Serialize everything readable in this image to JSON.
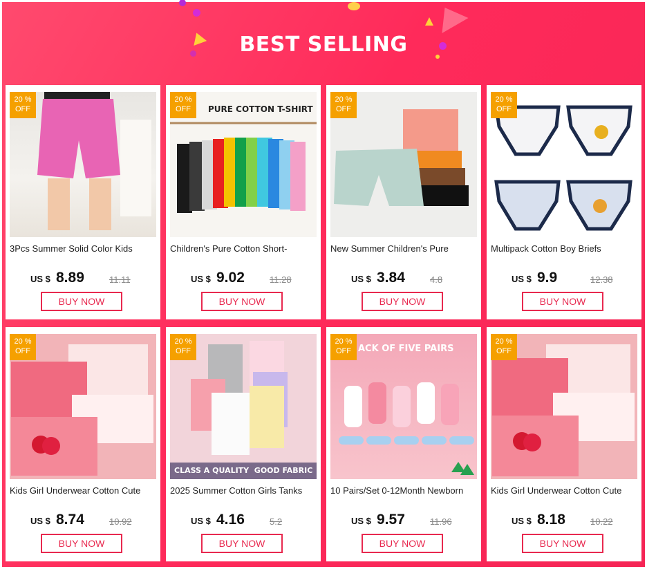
{
  "banner": {
    "title": "BEST SELLING"
  },
  "products": [
    {
      "badge_top": "20 %",
      "badge_bottom": "OFF",
      "title": "3Pcs Summer Solid Color Kids",
      "currency": "US $",
      "price": "8.89",
      "old_price": "11.11",
      "button": "BUY NOW"
    },
    {
      "badge_top": "20 %",
      "badge_bottom": "OFF",
      "title": "Children's Pure Cotton Short-",
      "currency": "US $",
      "price": "9.02",
      "old_price": "11.28",
      "button": "BUY NOW",
      "image_text": "PURE COTTON T-SHIRT"
    },
    {
      "badge_top": "20 %",
      "badge_bottom": "OFF",
      "title": "New Summer Children's Pure",
      "currency": "US $",
      "price": "3.84",
      "old_price": "4.8",
      "button": "BUY NOW"
    },
    {
      "badge_top": "20 %",
      "badge_bottom": "OFF",
      "title": "Multipack Cotton Boy Briefs",
      "currency": "US $",
      "price": "9.9",
      "old_price": "12.38",
      "button": "BUY NOW"
    },
    {
      "badge_top": "20 %",
      "badge_bottom": "OFF",
      "title": "Kids Girl Underwear Cotton Cute",
      "currency": "US $",
      "price": "8.74",
      "old_price": "10.92",
      "button": "BUY NOW"
    },
    {
      "badge_top": "20 %",
      "badge_bottom": "OFF",
      "title": "2025 Summer Cotton Girls Tanks",
      "currency": "US $",
      "price": "4.16",
      "old_price": "5.2",
      "button": "BUY NOW",
      "image_text": "CLASS A QUALITY  GOOD FABRIC"
    },
    {
      "badge_top": "20 %",
      "badge_bottom": "OFF",
      "title": "10 Pairs/Set 0-12Month Newborn",
      "currency": "US $",
      "price": "9.57",
      "old_price": "11.96",
      "button": "BUY NOW",
      "image_text": "ACK OF FIVE PAIRS"
    },
    {
      "badge_top": "20 %",
      "badge_bottom": "OFF",
      "title": "Kids Girl Underwear Cotton Cute",
      "currency": "US $",
      "price": "8.18",
      "old_price": "10.22",
      "button": "BUY NOW"
    }
  ]
}
